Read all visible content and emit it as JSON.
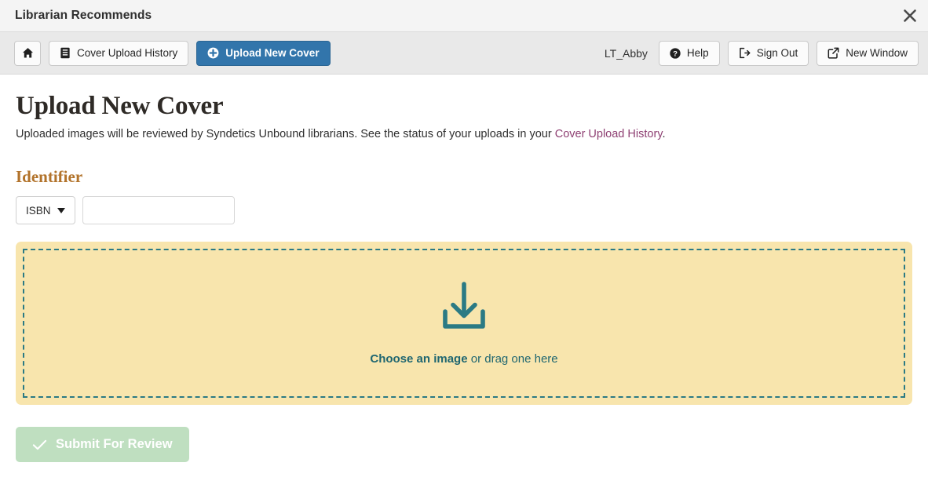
{
  "window": {
    "title": "Librarian Recommends",
    "close_icon": "close-icon"
  },
  "toolbar": {
    "home_icon": "home-icon",
    "tabs": [
      {
        "label": "Cover Upload History",
        "icon": "book-icon",
        "active": false
      },
      {
        "label": "Upload New Cover",
        "icon": "plus-circle-icon",
        "active": true
      }
    ],
    "user_name": "LT_Abby",
    "actions": [
      {
        "label": "Help",
        "icon": "question-circle-icon"
      },
      {
        "label": "Sign Out",
        "icon": "sign-out-icon"
      },
      {
        "label": "New Window",
        "icon": "external-link-icon"
      }
    ]
  },
  "main": {
    "title": "Upload New Cover",
    "description_before": "Uploaded images will be reviewed by Syndetics Unbound librarians. See the status of your uploads in your ",
    "description_link": "Cover Upload History",
    "description_after": ".",
    "identifier": {
      "label": "Identifier",
      "select_value": "ISBN",
      "select_options": [
        "ISBN"
      ],
      "input_value": "",
      "input_placeholder": ""
    },
    "dropzone": {
      "icon": "download-arrow-icon",
      "cta": "Choose an image",
      "rest": " or drag one here"
    },
    "submit": {
      "label": "Submit For Review",
      "icon": "check-icon",
      "enabled": false
    }
  },
  "colors": {
    "accent_blue": "#3275ab",
    "link_purple": "#8e3f72",
    "section_orange": "#b2732b",
    "dropzone_bg": "#f8e5ad",
    "dropzone_border": "#2b7a84",
    "teal_text": "#1f6670",
    "submit_bg": "#bfdfc0"
  }
}
